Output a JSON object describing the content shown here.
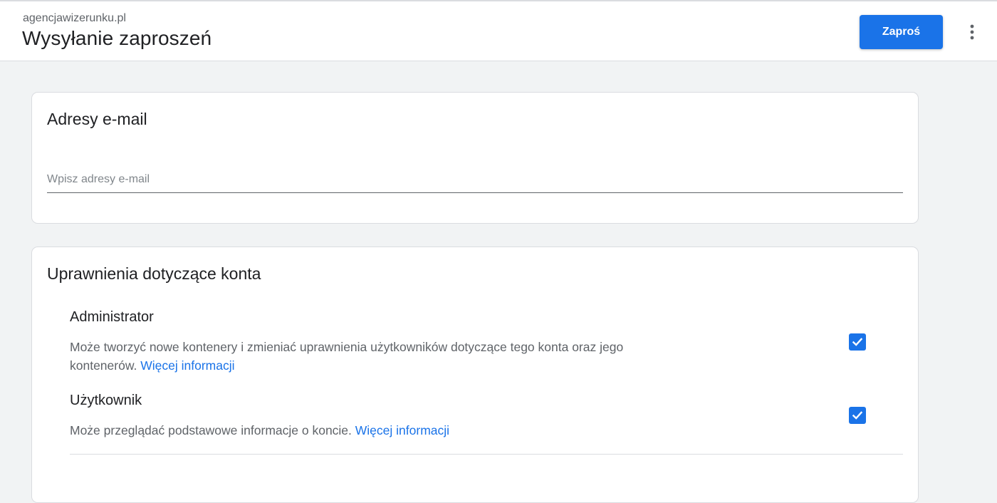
{
  "header": {
    "account": "agencjawizerunku.pl",
    "title": "Wysyłanie zaproszeń",
    "invite_label": "Zaproś",
    "more_icon": "more-vert-icon"
  },
  "email_section": {
    "title": "Adresy e-mail",
    "input_placeholder": "Wpisz adresy e-mail",
    "input_value": ""
  },
  "permissions_section": {
    "title": "Uprawnienia dotyczące konta",
    "roles": [
      {
        "name": "Administrator",
        "description": "Może tworzyć nowe kontenery i zmieniać uprawnienia użytkowników dotyczące tego konta oraz jego kontenerów.",
        "link": "Więcej informacji",
        "checked": true
      },
      {
        "name": "Użytkownik",
        "description": "Może przeglądać podstawowe informacje o koncie.",
        "link": "Więcej informacji",
        "checked": true
      }
    ]
  },
  "colors": {
    "accent": "#1a73e8",
    "background": "#f1f3f4",
    "card": "#ffffff",
    "text_primary": "#202124",
    "text_secondary": "#5f6368"
  }
}
